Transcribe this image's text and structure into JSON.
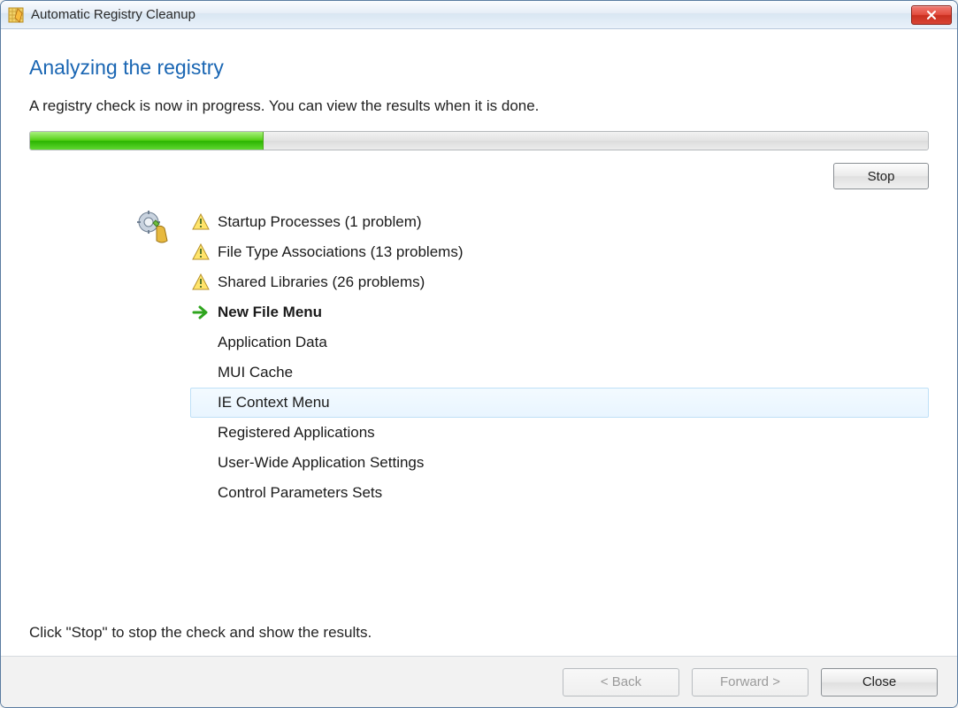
{
  "window": {
    "title": "Automatic Registry Cleanup"
  },
  "main": {
    "heading": "Analyzing the registry",
    "description": "A registry check is now in progress. You can view the results when it is done.",
    "progress_percent": 26,
    "stop_label": "Stop",
    "hint": "Click \"Stop\" to stop the check and show the results.",
    "items": [
      {
        "label": "Startup Processes (1 problem)",
        "state": "done"
      },
      {
        "label": "File Type Associations (13 problems)",
        "state": "done"
      },
      {
        "label": "Shared Libraries (26 problems)",
        "state": "done"
      },
      {
        "label": "New File Menu",
        "state": "current"
      },
      {
        "label": "Application Data",
        "state": "pending"
      },
      {
        "label": "MUI Cache",
        "state": "pending"
      },
      {
        "label": "IE Context Menu",
        "state": "pending",
        "hovered": true
      },
      {
        "label": "Registered Applications",
        "state": "pending"
      },
      {
        "label": "User-Wide Application Settings",
        "state": "pending"
      },
      {
        "label": "Control Parameters Sets",
        "state": "pending"
      }
    ]
  },
  "footer": {
    "back_label": "< Back",
    "forward_label": "Forward >",
    "close_label": "Close"
  }
}
